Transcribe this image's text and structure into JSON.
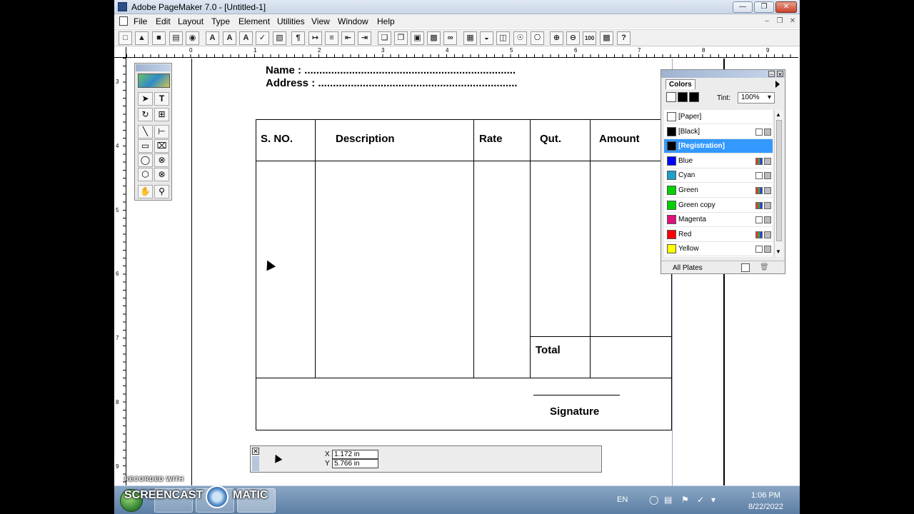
{
  "window": {
    "title": "Adobe PageMaker 7.0 - [Untitled-1]"
  },
  "menu": [
    "File",
    "Edit",
    "Layout",
    "Type",
    "Element",
    "Utilities",
    "View",
    "Window",
    "Help"
  ],
  "toolbar": {
    "help_label": "?",
    "zoom_label": "100"
  },
  "ruler_h": [
    "0",
    "1",
    "2",
    "3",
    "4",
    "5",
    "6",
    "7",
    "8",
    "9"
  ],
  "ruler_v": [
    "3",
    "4",
    "5",
    "6",
    "7",
    "8",
    "9"
  ],
  "toolbox": {
    "text_tool": "T"
  },
  "invoice": {
    "name_line": "Name : .......................................................................",
    "address_line": "Address : ...................................................................",
    "columns": [
      "S. NO.",
      "Description",
      "Rate",
      "Qut.",
      "Amount"
    ],
    "total_label": "Total",
    "signature_label": "Signature"
  },
  "colors_panel": {
    "tab": "Colors",
    "tint_label": "Tint:",
    "tint_value": "100%",
    "footer": "All Plates",
    "colors": [
      {
        "name": "[Paper]",
        "swatch": "#ffffff",
        "selected": false
      },
      {
        "name": "[Black]",
        "swatch": "#000000",
        "selected": false
      },
      {
        "name": "[Registration]",
        "swatch": "#000000",
        "selected": true
      },
      {
        "name": "Blue",
        "swatch": "#0000ff",
        "selected": false
      },
      {
        "name": "Cyan",
        "swatch": "#1fa0c8",
        "selected": false
      },
      {
        "name": "Green",
        "swatch": "#00d000",
        "selected": false
      },
      {
        "name": "Green copy",
        "swatch": "#00d000",
        "selected": false
      },
      {
        "name": "Magenta",
        "swatch": "#e0107a",
        "selected": false
      },
      {
        "name": "Red",
        "swatch": "#ff0000",
        "selected": false
      },
      {
        "name": "Yellow",
        "swatch": "#ffff00",
        "selected": false
      }
    ]
  },
  "control_palette": {
    "x_label": "X",
    "y_label": "Y",
    "x_value": "1.172 in",
    "y_value": "5.766 in"
  },
  "taskbar": {
    "language": "EN",
    "time": "1:06 PM",
    "date": "8/22/2022"
  },
  "watermark": {
    "small": "RECORDED WITH",
    "big": "SCREENCAST",
    "big2": "MATIC"
  }
}
